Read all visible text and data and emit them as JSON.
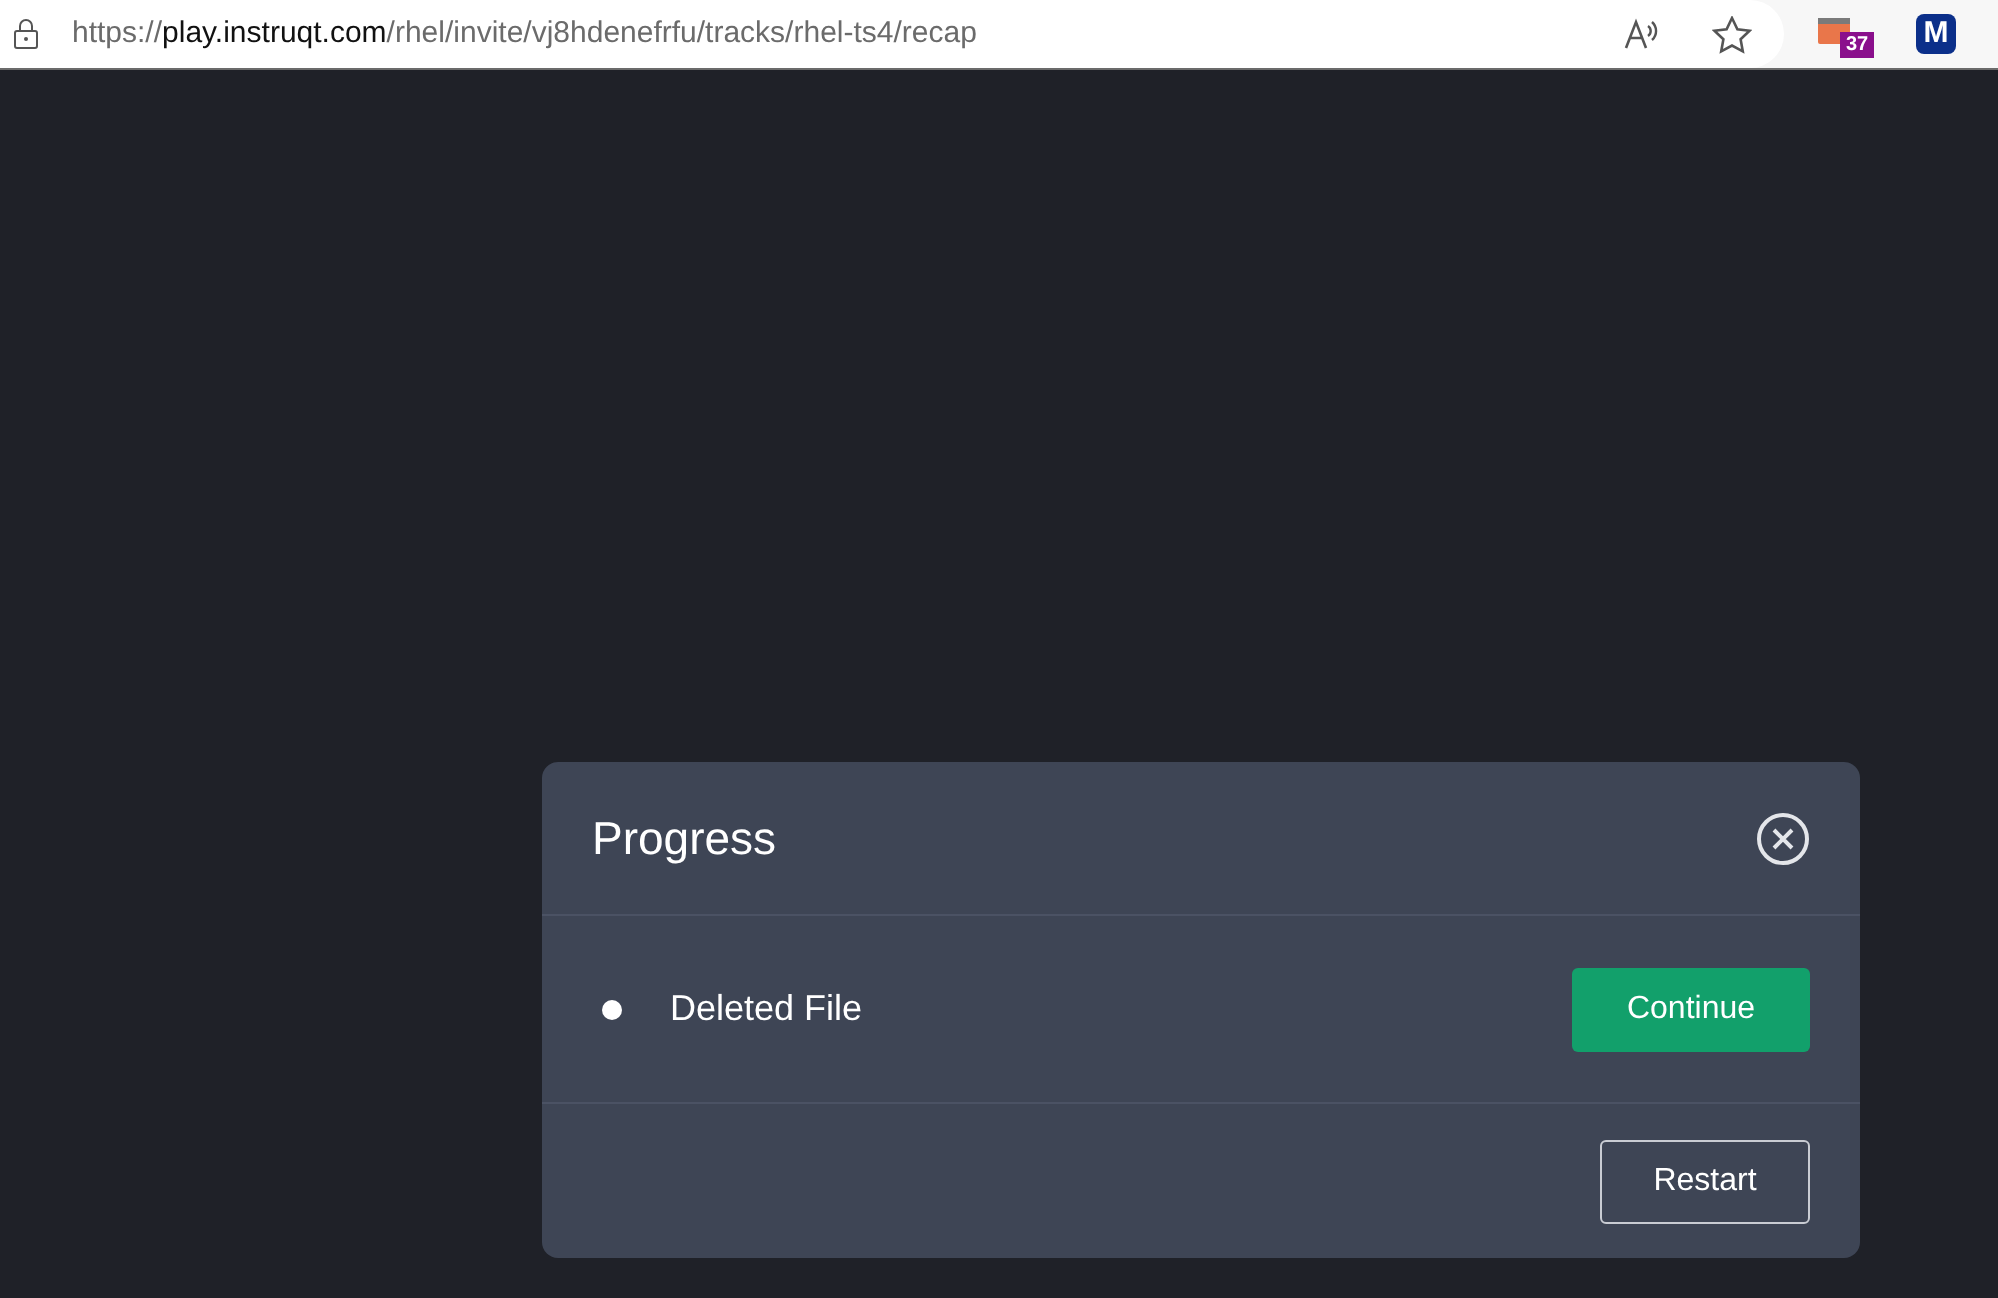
{
  "browser": {
    "url": {
      "scheme": "https://",
      "host": "play.instruqt.com",
      "path": "/rhel/invite/vj8hdenefrfu/tracks/rhel-ts4/recap"
    },
    "extension_badge": "37",
    "profile_letter": "M"
  },
  "dialog": {
    "title": "Progress",
    "steps": [
      {
        "label": "Deleted File",
        "action": {
          "label": "Continue",
          "kind": "primary"
        }
      }
    ],
    "footer_buttons": [
      {
        "label": "Restart",
        "kind": "outline"
      }
    ]
  }
}
